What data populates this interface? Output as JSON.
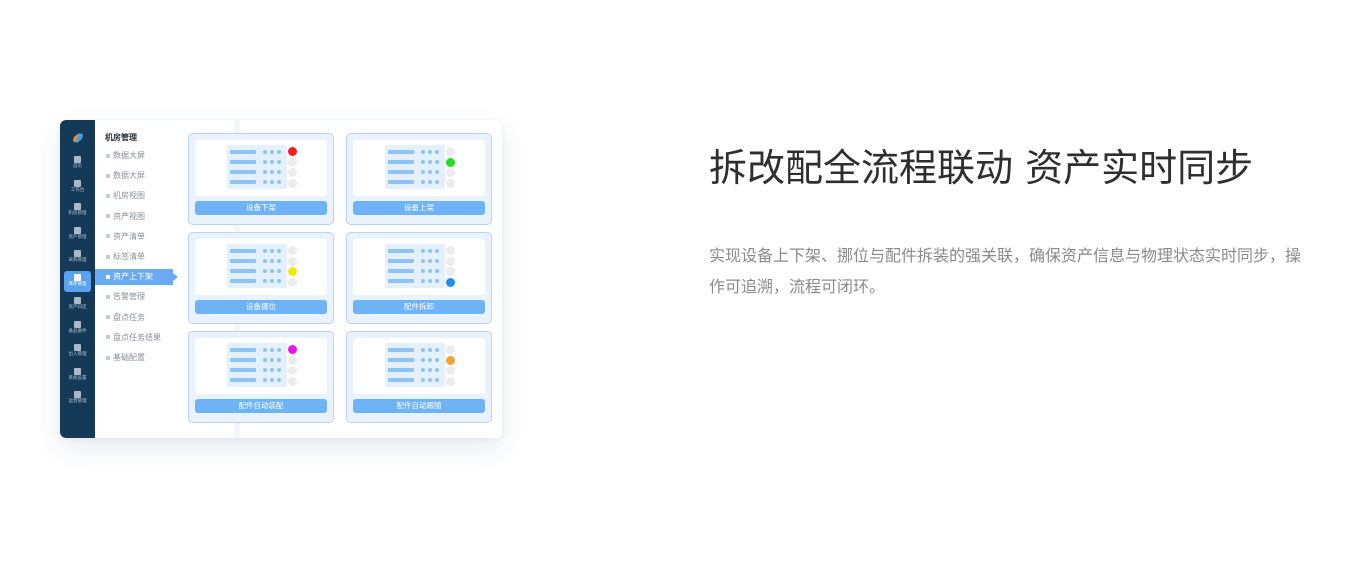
{
  "rail": {
    "items": [
      {
        "label": "首页"
      },
      {
        "label": "工作台"
      },
      {
        "label": "机房管理"
      },
      {
        "label": "资产管理"
      },
      {
        "label": "采购管理"
      },
      {
        "label": "库存管理"
      },
      {
        "label": "资产归还"
      },
      {
        "label": "备品备件"
      },
      {
        "label": "出入管理"
      },
      {
        "label": "系统设置"
      },
      {
        "label": "运营管理"
      }
    ],
    "active_index": 5
  },
  "menu": {
    "title": "机房管理",
    "items": [
      {
        "label": "数据大屏"
      },
      {
        "label": "数据大屏"
      },
      {
        "label": "机房视图"
      },
      {
        "label": "资产视图"
      },
      {
        "label": "资产清单"
      },
      {
        "label": "标签清单"
      },
      {
        "label": "资产上下架"
      },
      {
        "label": "告警管理"
      },
      {
        "label": "盘点任务"
      },
      {
        "label": "盘点任务结果"
      },
      {
        "label": "基础配置"
      }
    ],
    "active_index": 6
  },
  "cards": [
    {
      "label": "设备下架",
      "led_index": 0,
      "led_color": "#ff1a1a"
    },
    {
      "label": "设备上架",
      "led_index": 1,
      "led_color": "#22dd22"
    },
    {
      "label": "设备挪位",
      "led_index": 2,
      "led_color": "#f5e90a"
    },
    {
      "label": "配件拆卸",
      "led_index": 3,
      "led_color": "#1f8ff0"
    },
    {
      "label": "配件自动装配",
      "led_index": 0,
      "led_color": "#ee10ee"
    },
    {
      "label": "配件自动跟随",
      "led_index": 1,
      "led_color": "#f5a13a"
    }
  ],
  "headline": "拆改配全流程联动 资产实时同步",
  "description": "实现设备上下架、挪位与配件拆装的强关联，确保资产信息与物理状态实时同步，操作可追溯，流程可闭环。",
  "colors": {
    "rail": "#143a57",
    "accent": "#6aaaf2",
    "card_button": "#6fb3f7"
  }
}
